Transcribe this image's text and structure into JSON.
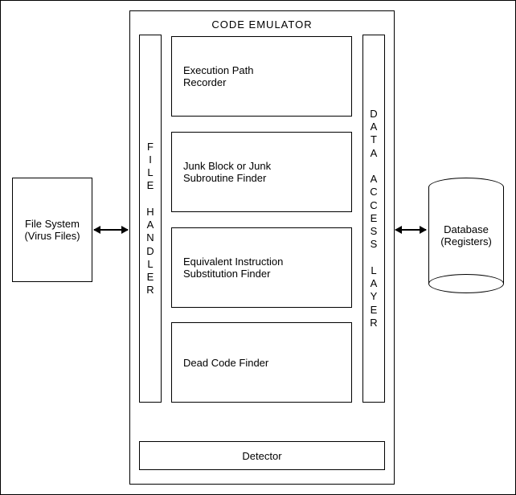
{
  "diagram": {
    "title": "CODE  EMULATOR",
    "file_system": {
      "line1": "File System",
      "line2": "(Virus Files)"
    },
    "file_handler_label": "FILE HANDLER",
    "data_access_layer_label": "DATA ACCESS LAYER",
    "modules": {
      "exec_path": {
        "line1": "Execution Path",
        "line2": "Recorder"
      },
      "junk": {
        "line1": "Junk Block or  Junk",
        "line2": "Subroutine  Finder"
      },
      "equiv": {
        "line1": "Equivalent Instruction",
        "line2": "Substitution Finder"
      },
      "dead": {
        "line1": "Dead Code Finder"
      }
    },
    "detector": "Detector",
    "database": {
      "line1": "Database",
      "line2": "(Registers)"
    }
  }
}
